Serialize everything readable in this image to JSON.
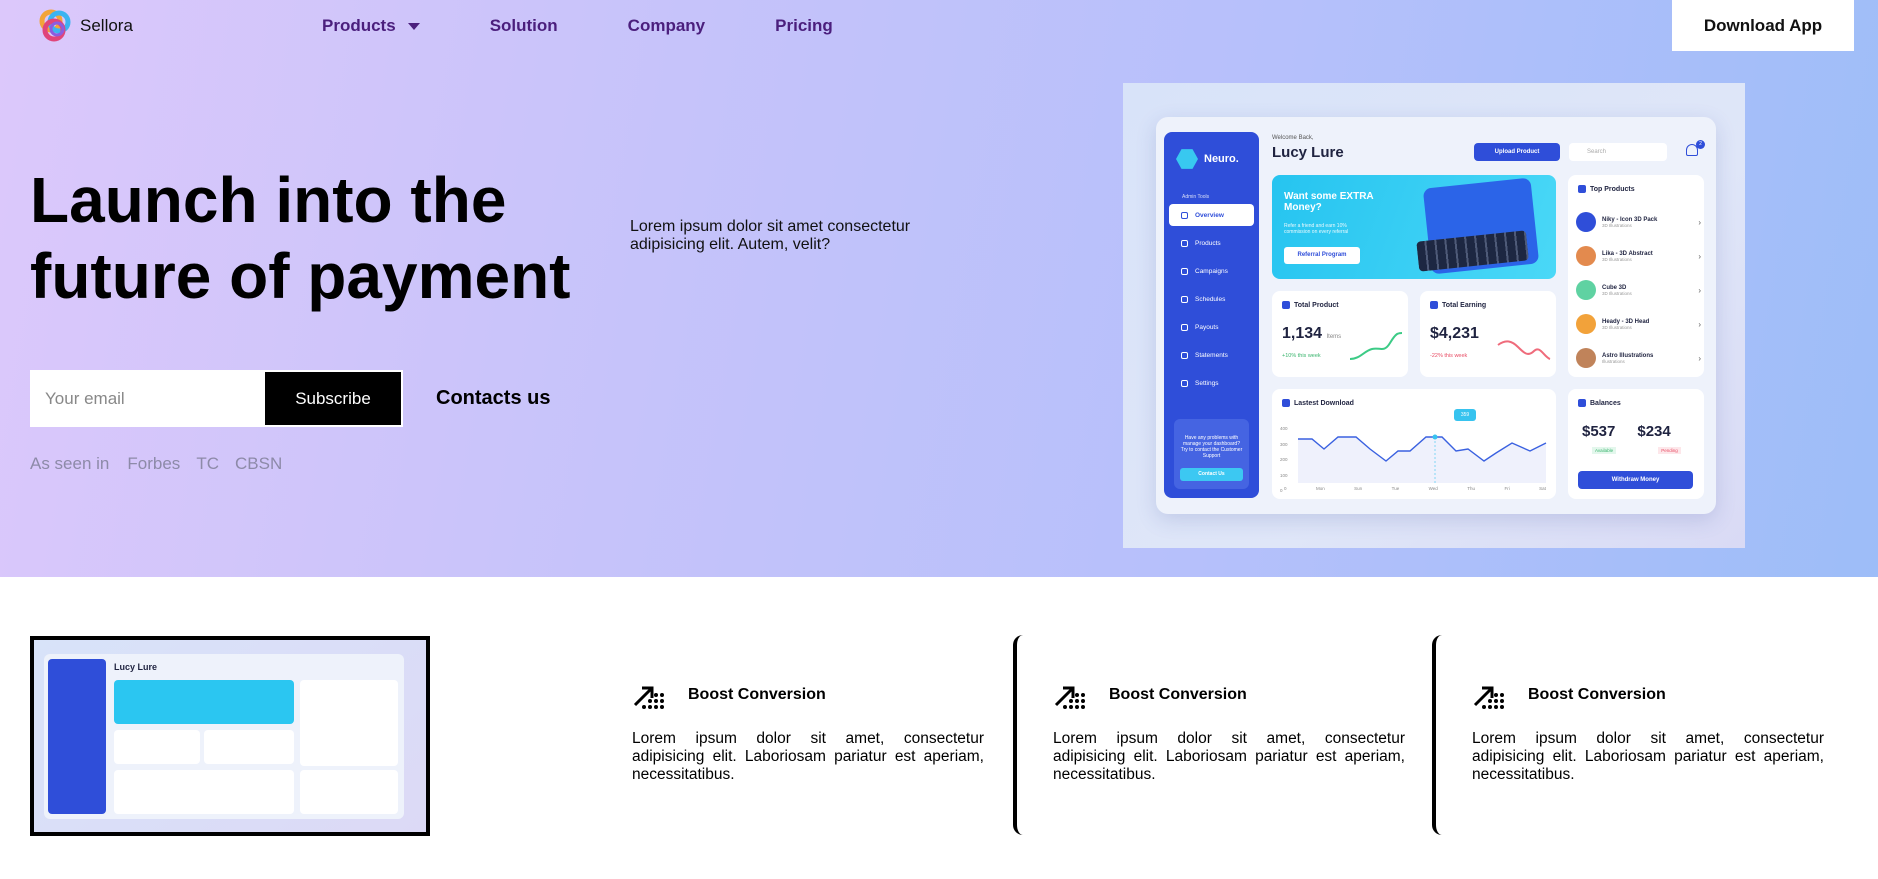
{
  "header": {
    "brand": "Sellora",
    "nav": [
      {
        "label": "Products",
        "has_dropdown": true
      },
      {
        "label": "Solution"
      },
      {
        "label": "Company"
      },
      {
        "label": "Pricing"
      }
    ],
    "cta": "Download App"
  },
  "hero": {
    "headline": "Launch into the future of payment",
    "lead": "Lorem ipsum dolor sit amet consectetur adipisicing elit. Autem, velit?",
    "email_placeholder": "Your email",
    "subscribe_label": "Subscribe",
    "contacts_label": "Contacts us",
    "as_seen": {
      "label": "As seen in",
      "brands": [
        "Forbes",
        "TC",
        "CBSN"
      ]
    }
  },
  "dashboard": {
    "brand": "Neuro.",
    "sidebar_section": "Admin Tools",
    "sidebar_items": [
      "Overview",
      "Products",
      "Campaigns",
      "Schedules",
      "Payouts",
      "Statements",
      "Settings"
    ],
    "help_text": "Have any problems with manage your dashboard? Try to contact the Customer Support",
    "help_button": "Contact Us",
    "welcome": "Welcome Back,",
    "user_name": "Lucy Lure",
    "upload_button": "Upload Product",
    "search_placeholder": "Search",
    "notification_count": "2",
    "promo": {
      "title": "Want some EXTRA Money?",
      "subtitle": "Refer a friend and earn 10% commission on every referral",
      "button": "Referral Program"
    },
    "total_product": {
      "title": "Total Product",
      "value": "1,134",
      "unit": "Items",
      "delta": "+10% this week"
    },
    "total_earning": {
      "title": "Total Earning",
      "value": "$4,231",
      "delta": "-22% this week"
    },
    "latest_download": {
      "title": "Lastest Download",
      "callout": "359",
      "y_ticks": [
        "400",
        "300",
        "200",
        "100",
        "0"
      ],
      "x_labels": [
        "Mon",
        "Sun",
        "Tue",
        "Wed",
        "Thu",
        "Fri",
        "Sat"
      ]
    },
    "top_products": {
      "title": "Top Products",
      "items": [
        {
          "name": "Niky - Icon 3D Pack",
          "sub": "3D Illustrations",
          "color": "#2f4ed9"
        },
        {
          "name": "Lika - 3D Abstract",
          "sub": "3D Illustrations",
          "color": "#e38a4e"
        },
        {
          "name": "Cube 3D",
          "sub": "3D Illustrations",
          "color": "#5fd2a2"
        },
        {
          "name": "Heady - 3D Head",
          "sub": "3D Illustrations",
          "color": "#f2a23a"
        },
        {
          "name": "Astro Illustrations",
          "sub": "Illustrations",
          "color": "#c0835a"
        }
      ]
    },
    "balances": {
      "title": "Balances",
      "available_value": "$537",
      "available_label": "Available",
      "pending_value": "$234",
      "pending_label": "Pending",
      "button": "Withdraw Money"
    }
  },
  "features": [
    {
      "title": "Boost Conversion",
      "text": "Lorem ipsum dolor sit amet, consectetur adipisicing elit. Laboriosam pariatur est aperiam, necessitatibus."
    },
    {
      "title": "Boost Conversion",
      "text": "Lorem ipsum dolor sit amet, consectetur adipisicing elit. Laboriosam pariatur est aperiam, necessitatibus."
    },
    {
      "title": "Boost Conversion",
      "text": "Lorem ipsum dolor sit amet, consectetur adipisicing elit. Laboriosam pariatur est aperiam, necessitatibus."
    }
  ],
  "colors": {
    "accent": "#2f4ed9",
    "nav_text": "#4b1f7d",
    "promo": "#26c4f0"
  }
}
